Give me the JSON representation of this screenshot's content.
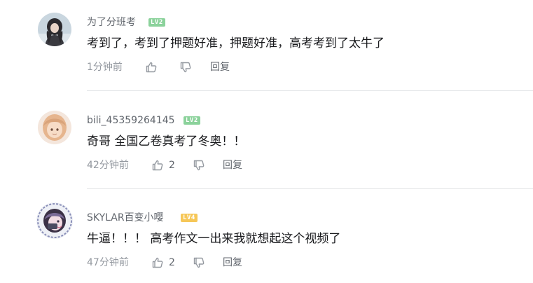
{
  "comments": [
    {
      "username": "为了分班考",
      "level": "LV2",
      "level_color": "#8bd29b",
      "content": "考到了，考到了押题好准，押题好准，高考考到了太牛了",
      "time": "1分钟前",
      "like_count": "",
      "reply_label": "回复"
    },
    {
      "username": "bili_45359264145",
      "level": "LV2",
      "level_color": "#8bd29b",
      "content": "奇哥 全国乙卷真考了冬奥！！",
      "time": "42分钟前",
      "like_count": "2",
      "reply_label": "回复"
    },
    {
      "username": "SKYLAR百变小嘤",
      "level": "LV4",
      "level_color": "#f6c758",
      "content": "牛逼！！！ 高考作文一出来我就想起这个视频了",
      "time": "47分钟前",
      "like_count": "2",
      "reply_label": "回复"
    }
  ],
  "colors": {
    "text_primary": "#18191c",
    "text_secondary": "#61666d",
    "text_meta": "#9499a0",
    "divider": "#e3e5e7"
  },
  "icons": {
    "like": "thumbs-up-icon",
    "dislike": "thumbs-down-icon"
  }
}
